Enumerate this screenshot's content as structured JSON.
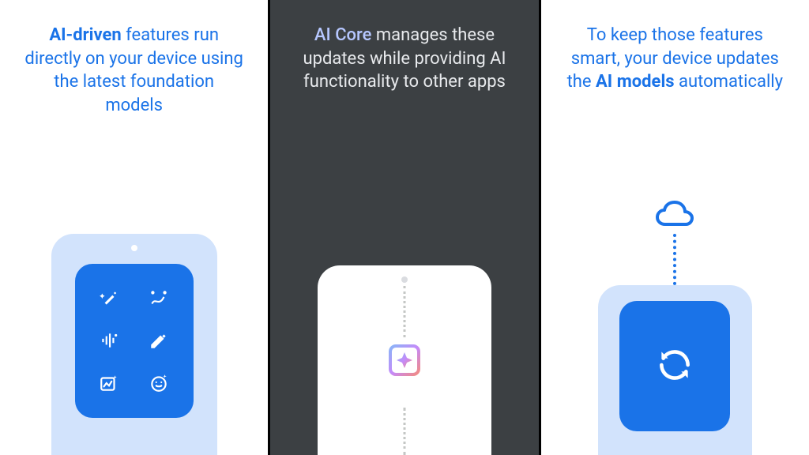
{
  "panel1": {
    "bold": "AI-driven",
    "rest": " features run directly on your device using the latest foundation models"
  },
  "panel2": {
    "bold": "AI Core",
    "rest": " manages these updates while providing AI functionality to other apps"
  },
  "panel3": {
    "pre": "To keep those features smart, your device updates the ",
    "bold": "AI models",
    "post": " automatically"
  }
}
